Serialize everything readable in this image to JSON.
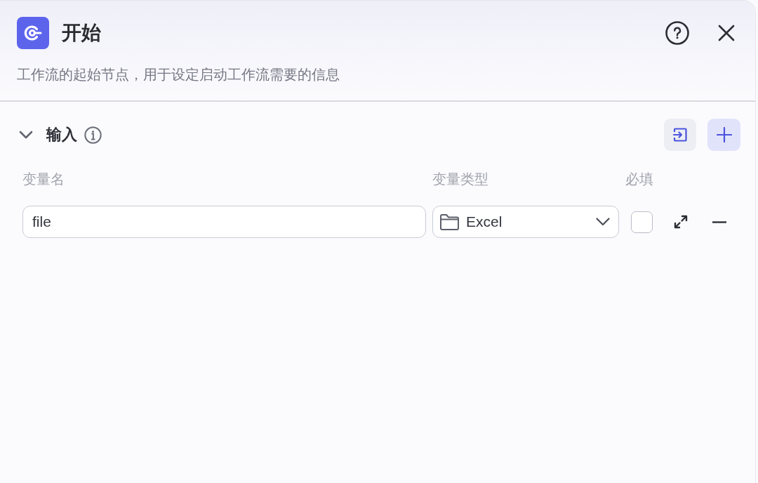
{
  "header": {
    "title": "开始",
    "description": "工作流的起始节点，用于设定启动工作流需要的信息"
  },
  "input_section": {
    "title": "输入",
    "expanded": true,
    "columns": [
      "变量名",
      "变量类型",
      "必填"
    ],
    "variables": [
      {
        "name": "file",
        "type": "Excel",
        "required": false
      }
    ]
  }
}
